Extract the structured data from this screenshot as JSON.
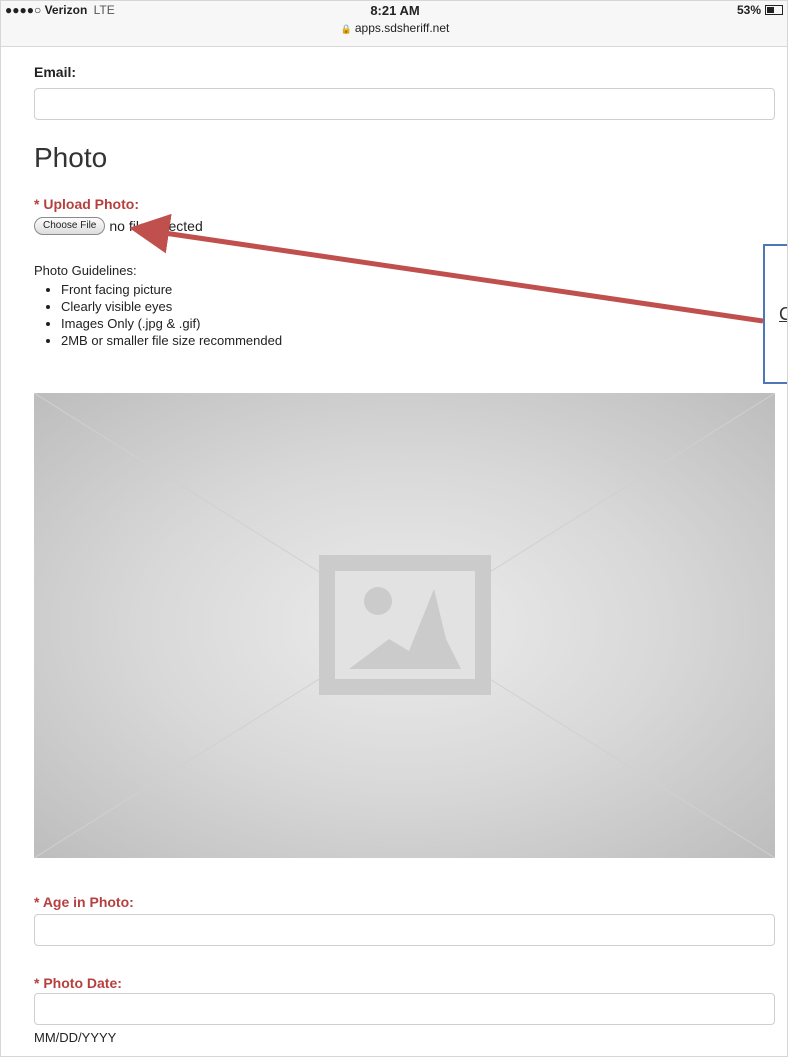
{
  "status_bar": {
    "signal": "●●●●○",
    "carrier": "Verizon",
    "network": "LTE",
    "time": "8:21 AM",
    "url": "apps.sdsheriff.net",
    "battery_text": "53%",
    "battery_level": 0.53
  },
  "form": {
    "email_label": "Email:",
    "email_value": "",
    "photo_heading": "Photo",
    "upload_label": "* Upload Photo:",
    "choose_file_label": "Choose File",
    "file_status": "no file selected",
    "guidelines_title": "Photo Guidelines:",
    "guidelines": [
      "Front facing picture",
      "Clearly visible eyes",
      "Images Only (.jpg & .gif)",
      "2MB or smaller file size recommended"
    ],
    "age_label": "* Age in Photo:",
    "age_value": "",
    "date_label": "* Photo Date:",
    "date_value": "",
    "date_hint": "MM/DD/YYYY"
  },
  "annotation": {
    "callout_text": "C",
    "arrow_color": "#c0504d",
    "box_color": "#4d78b8"
  },
  "colors": {
    "required_label": "#b5403f"
  },
  "icons": {
    "image_placeholder": "image-placeholder-icon",
    "lock": "lock-icon",
    "battery": "battery-icon"
  }
}
